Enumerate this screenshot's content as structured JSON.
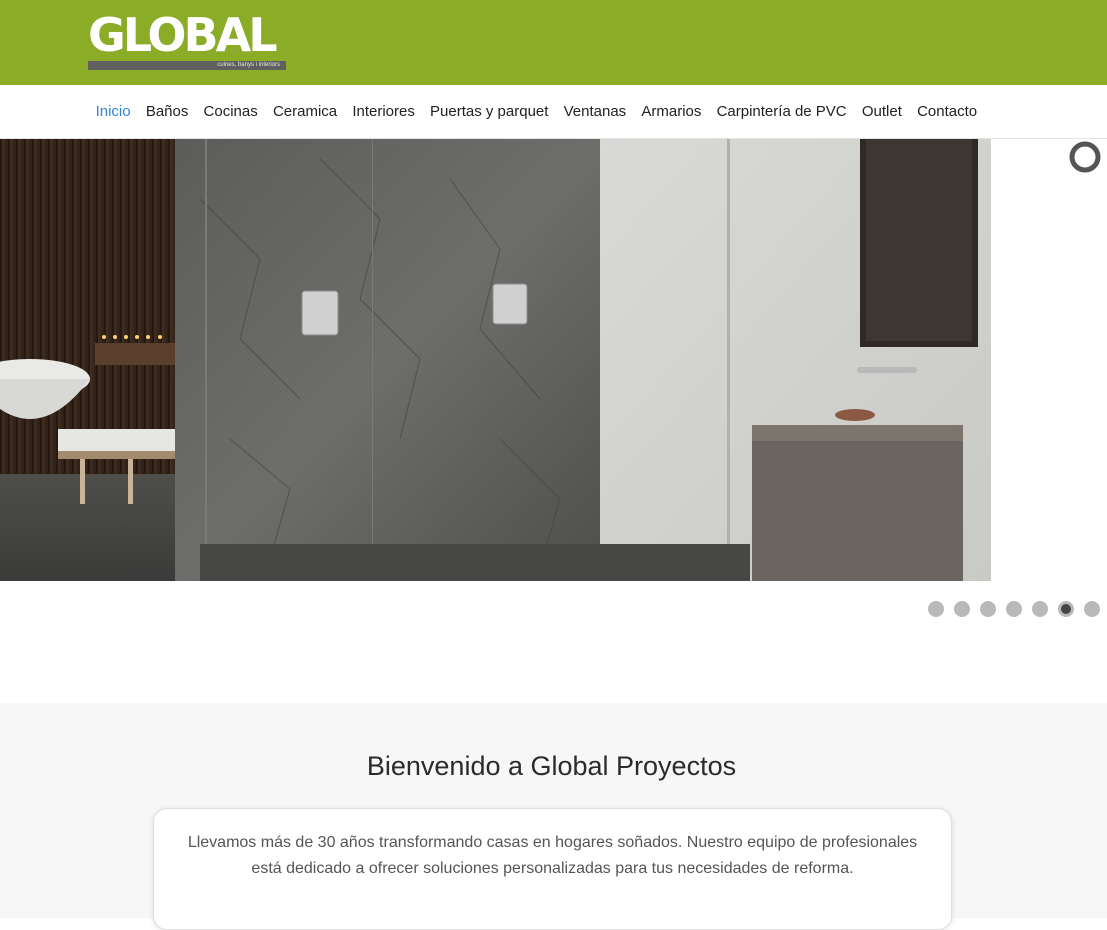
{
  "brand": {
    "name": "GLOBAL",
    "tagline": "cuines, banys i interiors",
    "color": "#8aac27"
  },
  "nav": {
    "items": [
      {
        "label": "Inicio",
        "active": true
      },
      {
        "label": "Baños"
      },
      {
        "label": "Cocinas"
      },
      {
        "label": "Ceramica"
      },
      {
        "label": "Interiores"
      },
      {
        "label": "Puertas y parquet"
      },
      {
        "label": "Ventanas"
      },
      {
        "label": "Armarios"
      },
      {
        "label": "Carpintería de PVC"
      },
      {
        "label": "Outlet"
      },
      {
        "label": "Contacto"
      }
    ],
    "active_color": "#2f86d6"
  },
  "slider": {
    "slide_count": 7,
    "active_slide": 6,
    "icons": {
      "loader": "loading-ring-icon"
    }
  },
  "welcome": {
    "title": "Bienvenido a Global Proyectos",
    "text": "Llevamos más de 30 años transformando casas en hogares soñados. Nuestro equipo de profesionales está dedicado a ofrecer soluciones personalizadas para tus necesidades de reforma."
  }
}
